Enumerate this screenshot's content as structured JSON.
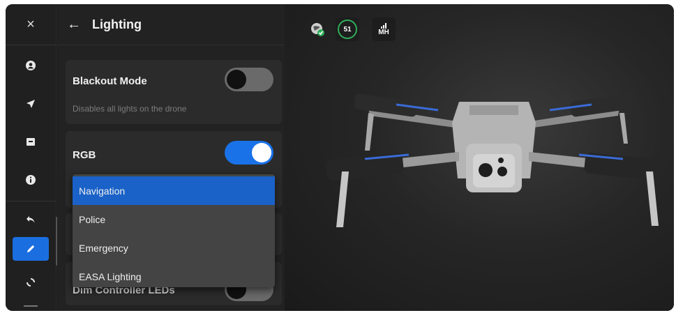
{
  "header": {
    "close_glyph": "×",
    "back_glyph": "←",
    "title": "Lighting"
  },
  "rail": {
    "items": [
      {
        "icon": "user-icon"
      },
      {
        "icon": "navigation-arrow-icon"
      },
      {
        "icon": "folder-icon"
      },
      {
        "icon": "info-icon"
      },
      {
        "icon": "undo-icon"
      },
      {
        "icon": "pencil-icon",
        "active": true
      },
      {
        "icon": "sync-icon"
      }
    ]
  },
  "blackout": {
    "title": "Blackout Mode",
    "subtitle": "Disables all lights on the drone",
    "enabled": false
  },
  "rgb": {
    "title": "RGB",
    "enabled": true
  },
  "dropdown": {
    "options": [
      "Navigation",
      "Police",
      "Emergency",
      "EASA Lighting"
    ],
    "selected": "Navigation"
  },
  "hidden_row": {
    "partial_label": "Dim Controller LEDs"
  },
  "status_bar": {
    "battery_value": "51",
    "signal_label": "MH"
  },
  "colors": {
    "accent": "#1a72e8",
    "selected": "#1a62c8",
    "ok": "#2fae5a"
  }
}
